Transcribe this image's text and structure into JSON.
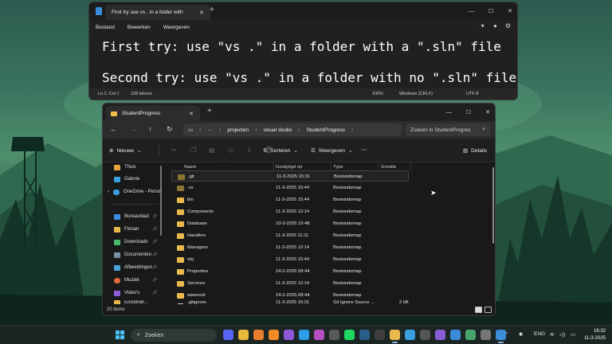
{
  "notepad": {
    "tab_title": "First try use vs . in a folder with",
    "menu": [
      "Bestand",
      "Bewerken",
      "Weergeven"
    ],
    "lines": [
      "First try: use \"vs .\" in a folder with a \".sln\" file",
      "Second try: use \"vs .\" in a folder with no \".sln\" file"
    ],
    "status": {
      "position": "Ln 2, Col 1",
      "chars": "108 tekens",
      "zoom": "100%",
      "line_ending": "Windows (CRLF)",
      "encoding": "UTF-8"
    }
  },
  "explorer": {
    "tab_title": "StudentProgress",
    "breadcrumb": [
      "projecten",
      "visual studio",
      "StudentProgress"
    ],
    "search_placeholder": "Zoeken in StudentProgres",
    "toolbar": {
      "new_label": "Nieuwe",
      "sort_label": "Sorteren",
      "view_label": "Weergeven",
      "more_label": "···",
      "details_label": "Details"
    },
    "sidebar": {
      "top": [
        {
          "label": "Thuis",
          "color": "#e6a23c"
        },
        {
          "label": "Galerie",
          "color": "#3aa0e0"
        },
        {
          "label": "OneDrive - Perso",
          "color": "#3aa0e0"
        }
      ],
      "pinned": [
        {
          "label": "Bureaublad",
          "color": "#3a8ee0"
        },
        {
          "label": "Florian",
          "color": "#e8b94a"
        },
        {
          "label": "Downloads",
          "color": "#4cb96b"
        },
        {
          "label": "Documenten",
          "color": "#7a8ea8"
        },
        {
          "label": "Afbeeldingen",
          "color": "#4aa0d8"
        },
        {
          "label": "Muziek",
          "color": "#e0693a"
        },
        {
          "label": "Video's",
          "color": "#8a5cd6"
        },
        {
          "label": "Einzelner...",
          "color": "#e8b94a"
        }
      ]
    },
    "columns": [
      "Naam",
      "Gewijzigd op",
      "Type",
      "Grootte"
    ],
    "rows": [
      {
        "name": ".git",
        "date": "11-3-2025 15:31",
        "type": "Bestandsmap",
        "size": "",
        "kind": "folder-dim"
      },
      {
        "name": ".vs",
        "date": "11-3-2025 15:44",
        "type": "Bestandsmap",
        "size": "",
        "kind": "folder-dim"
      },
      {
        "name": "bin",
        "date": "11-3-2025 15:44",
        "type": "Bestandsmap",
        "size": "",
        "kind": "folder"
      },
      {
        "name": "Components",
        "date": "11-3-2025 12:14",
        "type": "Bestandsmap",
        "size": "",
        "kind": "folder"
      },
      {
        "name": "Database",
        "date": "10-3-2025 10:48",
        "type": "Bestandsmap",
        "size": "",
        "kind": "folder"
      },
      {
        "name": "Handlers",
        "date": "11-3-2025 11:11",
        "type": "Bestandsmap",
        "size": "",
        "kind": "folder"
      },
      {
        "name": "Managers",
        "date": "11-3-2025 12:14",
        "type": "Bestandsmap",
        "size": "",
        "kind": "folder"
      },
      {
        "name": "obj",
        "date": "11-3-2025 15:44",
        "type": "Bestandsmap",
        "size": "",
        "kind": "folder"
      },
      {
        "name": "Properties",
        "date": "24-2-2025 08:44",
        "type": "Bestandsmap",
        "size": "",
        "kind": "folder"
      },
      {
        "name": "Services",
        "date": "11-3-2025 12:14",
        "type": "Bestandsmap",
        "size": "",
        "kind": "folder"
      },
      {
        "name": "wwwroot",
        "date": "24-2-2025 08:44",
        "type": "Bestandsmap",
        "size": "",
        "kind": "folder"
      },
      {
        "name": ".gitignore",
        "date": "11-3-2025 15:31",
        "type": "Git Ignore Source ...",
        "size": "2 kB",
        "kind": "file"
      }
    ],
    "status_count": "20 items"
  },
  "taskbar": {
    "search_label": "Zoeken",
    "apps": [
      {
        "name": "discord-icon",
        "color": "#5865f2"
      },
      {
        "name": "chrome-icon",
        "color": "#e6b93a"
      },
      {
        "name": "blender-icon",
        "color": "#e87d2d"
      },
      {
        "name": "vlc-icon",
        "color": "#f08a24"
      },
      {
        "name": "visual-studio-icon",
        "color": "#8f58d8"
      },
      {
        "name": "vscode-icon",
        "color": "#2c9de8"
      },
      {
        "name": "rider-icon",
        "color": "#b54ec0"
      },
      {
        "name": "notes-icon",
        "color": "#5a5a5a"
      },
      {
        "name": "spotify-icon",
        "color": "#1ed760"
      },
      {
        "name": "steam-icon",
        "color": "#2a5d8a"
      },
      {
        "name": "xbox-icon",
        "color": "#3e3e3e"
      },
      {
        "name": "file-explorer-icon",
        "color": "#e8b94a"
      },
      {
        "name": "app-store-icon",
        "color": "#3aa0e0"
      },
      {
        "name": "terminal-icon",
        "color": "#555555"
      },
      {
        "name": "github-icon",
        "color": "#8a5cd6"
      },
      {
        "name": "snipping-icon",
        "color": "#3c8dd9"
      },
      {
        "name": "devtool-icon",
        "color": "#47a36b"
      },
      {
        "name": "clock-app-icon",
        "color": "#777777"
      },
      {
        "name": "notepad-icon",
        "color": "#3c8dd9"
      }
    ],
    "language": "ENG",
    "time": "16:32",
    "date": "11-3-2025"
  }
}
